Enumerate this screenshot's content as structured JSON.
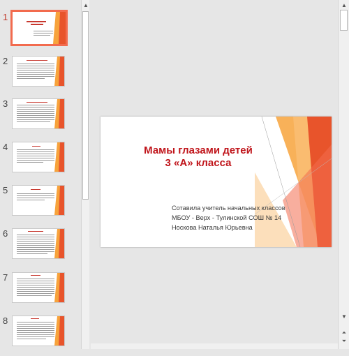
{
  "slides": [
    {
      "num": "1"
    },
    {
      "num": "2"
    },
    {
      "num": "3"
    },
    {
      "num": "4"
    },
    {
      "num": "5"
    },
    {
      "num": "6"
    },
    {
      "num": "7"
    },
    {
      "num": "8"
    }
  ],
  "current_slide": {
    "title_line1": "Мамы глазами детей",
    "title_line2": "3  «А» класса",
    "author_line1": "Сотавила учитель начальных классов",
    "author_line2": "МБОУ - Верх - Тулинской СОШ № 14",
    "author_line3": " Носкова Наталья Юрьевна"
  },
  "icons": {
    "scroll_up": "▲",
    "scroll_down": "▼",
    "prev_slide": "⏶",
    "next_slide": "⏷"
  },
  "colors": {
    "accent": "#f26b4e",
    "title": "#c0151b",
    "deco_orange": "#f7a33c",
    "deco_red": "#e8542b"
  }
}
